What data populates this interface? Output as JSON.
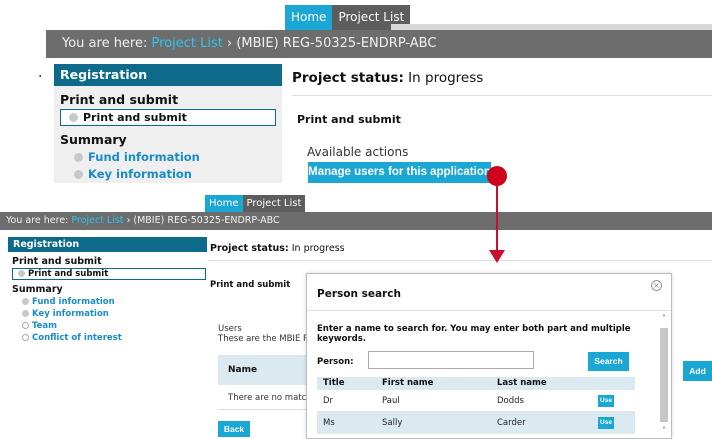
{
  "top": {
    "tabs": {
      "home": "Home",
      "project_list": "Project List"
    },
    "breadcrumb": {
      "prefix": "You are here: ",
      "link": "Project List",
      "separator": " › ",
      "current": "(MBIE) REG-50325-ENDRP-ABC"
    },
    "sidebar": {
      "header": "Registration",
      "section1": "Print and submit",
      "active_item": "Print and submit",
      "section2": "Summary",
      "items": [
        "Fund information",
        "Key information"
      ]
    },
    "status_label": "Project status:",
    "status_value": " In progress",
    "page_section": "Print and submit",
    "available_actions": "Available actions",
    "manage_button": "Manage users for this application",
    "left_mark": "."
  },
  "bottom": {
    "tabs": {
      "home": "Home",
      "project_list": "Project List"
    },
    "breadcrumb": {
      "prefix": "You are here: ",
      "link": "Project List",
      "separator": " › ",
      "current": "(MBIE) REG-50325-ENDRP-ABC"
    },
    "sidebar": {
      "header": "Registration",
      "section1": "Print and submit",
      "active_item": "Print and submit",
      "section2": "Summary",
      "items": [
        "Fund information",
        "Key information",
        "Team",
        "Conflict of interest"
      ]
    },
    "status_label": "Project status:",
    "status_value": " In progress",
    "page_section": "Print and submit",
    "users_heading": "Users",
    "users_desc": "These are the MBIE Por",
    "name_header": "Name",
    "no_match": "There are no matchin",
    "back_button": "Back",
    "add_button": "Add",
    "modal": {
      "title": "Person search",
      "instructions": "Enter a name to search for. You may enter both part and multiple keywords.",
      "person_label": "Person:",
      "person_value": "",
      "search_button": "Search",
      "columns": [
        "Title",
        "First name",
        "Last name"
      ],
      "rows": [
        {
          "title": "Dr",
          "first": "Paul",
          "last": "Dodds",
          "action": "Use"
        },
        {
          "title": "Ms",
          "first": "Sally",
          "last": "Carder",
          "action": "Use"
        }
      ]
    }
  },
  "colors": {
    "accent": "#1aa7d4",
    "sidebar_header": "#0e6a8b",
    "breadcrumb_bar": "#6d6d6d",
    "link": "#2ec4ef",
    "annotation": "#c8102e",
    "table_header": "#dbe9f1"
  },
  "icons": {
    "modal_close": "close-icon",
    "nav_bullet": "circle-bullet-icon"
  }
}
